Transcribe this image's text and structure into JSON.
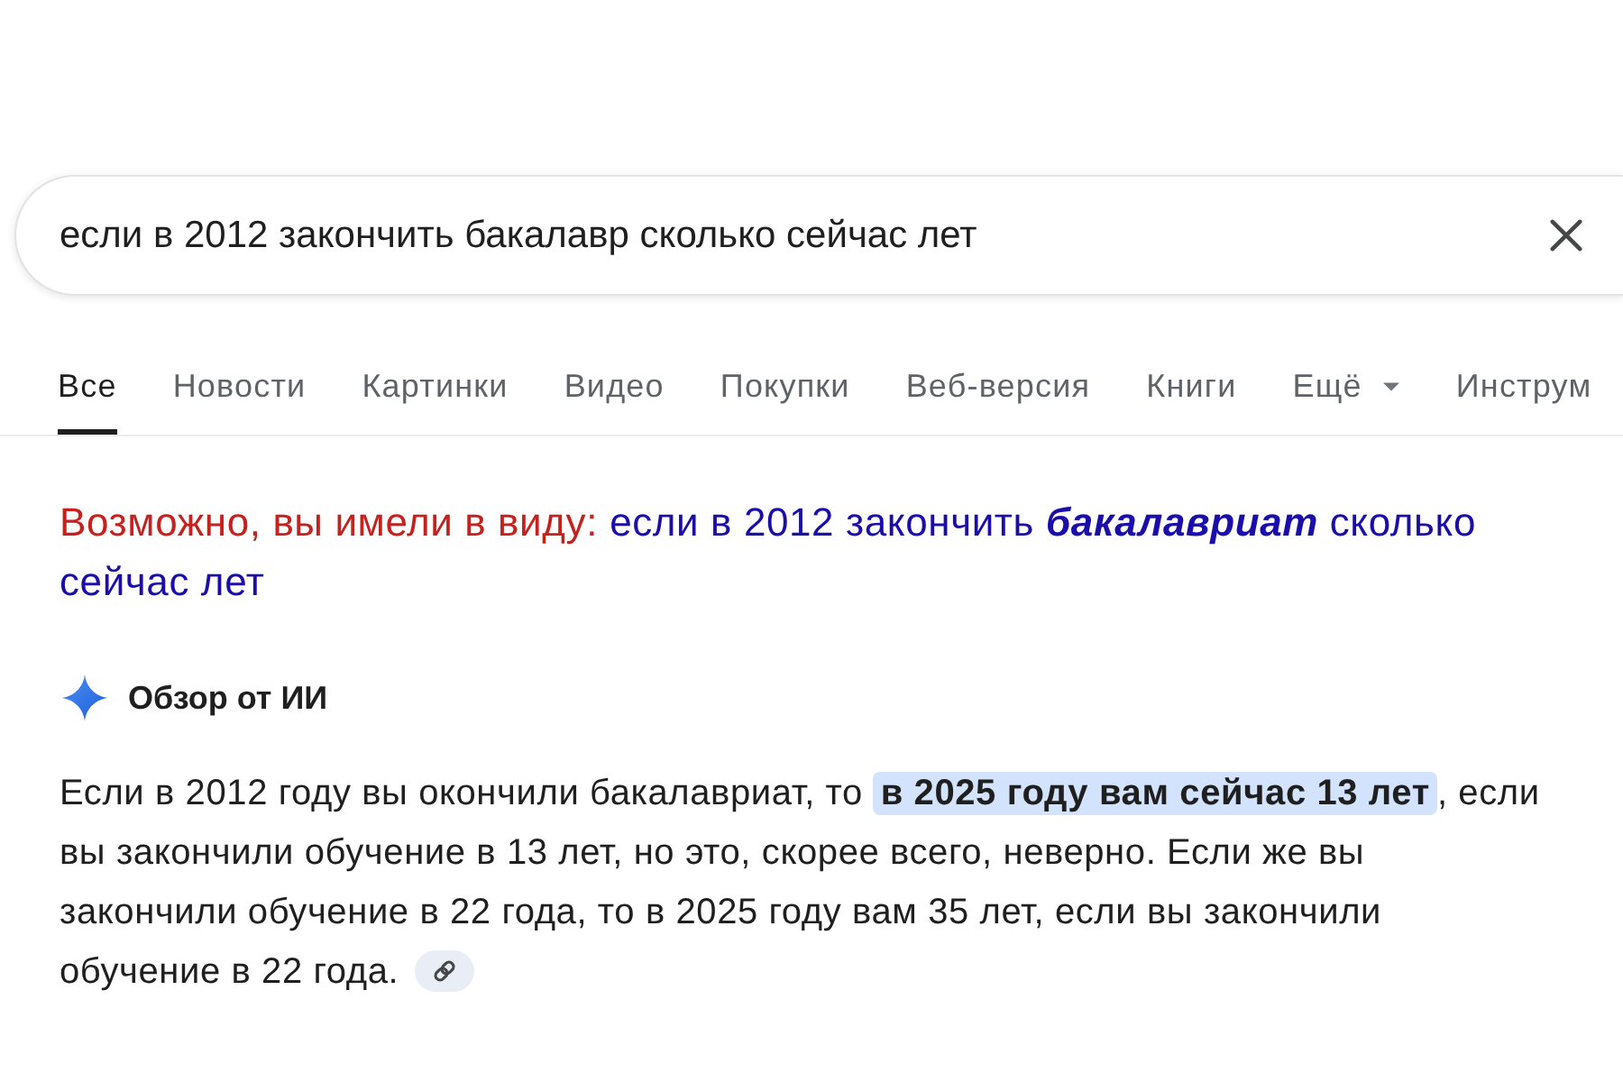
{
  "search": {
    "value": "если в 2012 закончить бакалавр сколько сейчас лет"
  },
  "tabs": [
    {
      "label": "Все",
      "selected": true,
      "kind": "tab"
    },
    {
      "label": "Новости",
      "selected": false,
      "kind": "tab"
    },
    {
      "label": "Картинки",
      "selected": false,
      "kind": "tab"
    },
    {
      "label": "Видео",
      "selected": false,
      "kind": "tab"
    },
    {
      "label": "Покупки",
      "selected": false,
      "kind": "tab"
    },
    {
      "label": "Веб-версия",
      "selected": false,
      "kind": "tab"
    },
    {
      "label": "Книги",
      "selected": false,
      "kind": "tab"
    },
    {
      "label": "Ещё",
      "selected": false,
      "kind": "menu"
    },
    {
      "label": "Инструм",
      "selected": false,
      "kind": "tab"
    }
  ],
  "suggestion": {
    "prefix": "Возможно, вы имели в виду:",
    "query": "если в 2012 закончить **бакалавриат** сколько сейчас лет"
  },
  "ai_overview": {
    "title": "Обзор от ИИ",
    "answer": "Если в 2012 году вы окончили бакалавриат, то **в 2025 году вам сейчас 13 лет**, если вы закончили обучение в 13 лет, но это, скорее всего, неверно. Если же вы закончили обучение в 22 года, то в 2025 году вам 35 лет, если вы закончили обучение в 22 года."
  }
}
